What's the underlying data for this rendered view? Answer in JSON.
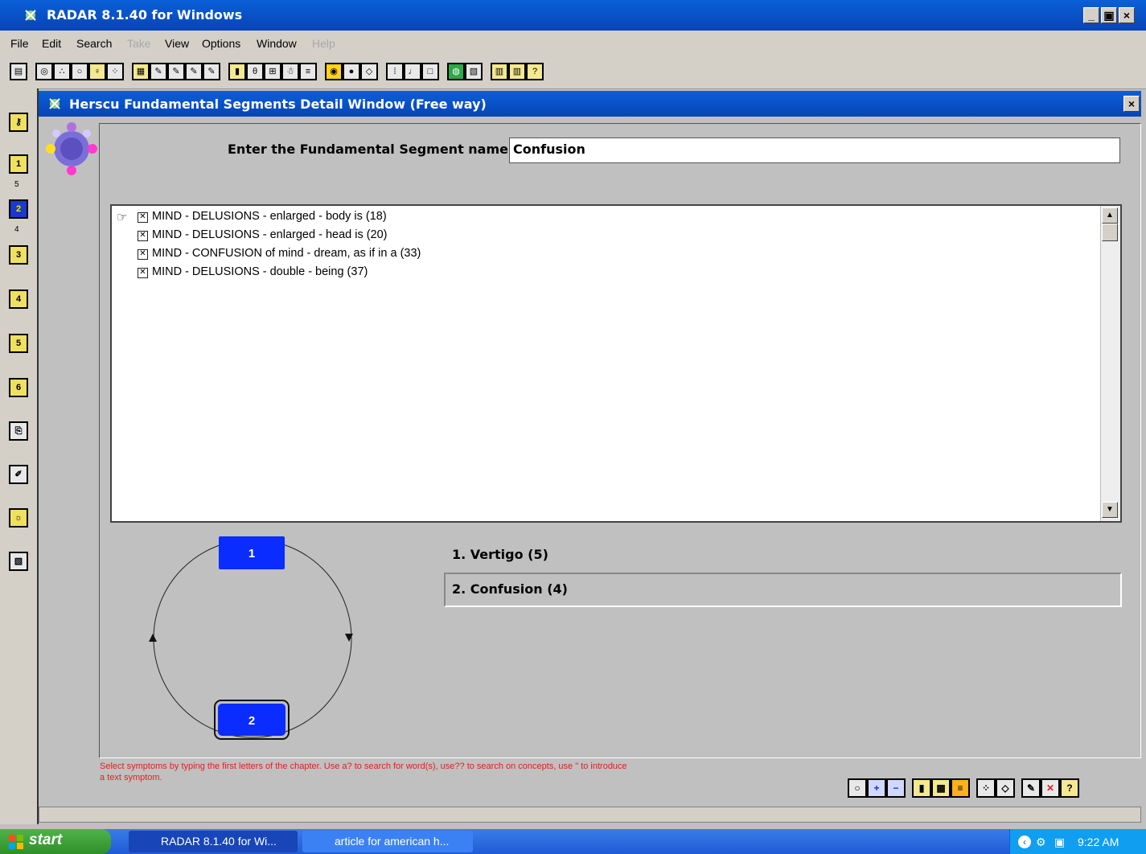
{
  "app": {
    "title": "RADAR 8.1.40 for Windows",
    "window_buttons": [
      "_",
      "▣",
      "×"
    ]
  },
  "menu": [
    {
      "label": "File",
      "enabled": true
    },
    {
      "label": "Edit",
      "enabled": true
    },
    {
      "label": "Search",
      "enabled": true
    },
    {
      "label": "Take",
      "enabled": false
    },
    {
      "label": "View",
      "enabled": true
    },
    {
      "label": "Options",
      "enabled": true
    },
    {
      "label": "Window",
      "enabled": true
    },
    {
      "label": "Help",
      "enabled": false
    }
  ],
  "left_strip": {
    "buttons": [
      "key",
      "1",
      "2",
      "3",
      "4",
      "5",
      "6",
      "copy",
      "chart-edit",
      "bulb",
      "book"
    ],
    "counts": {
      "c1": "5",
      "c2": "4"
    }
  },
  "inner_window": {
    "title": "Herscu Fundamental Segments Detail Window  (Free way)",
    "close": "×"
  },
  "segment": {
    "label": "Enter the Fundamental Segment name:",
    "value": "Confusion"
  },
  "rubrics": [
    "MIND - DELUSIONS - enlarged - body is (18)",
    "MIND - DELUSIONS - enlarged - head is (20)",
    "MIND - CONFUSION of mind - dream, as if in a (33)",
    "MIND - DELUSIONS - double - being (37)"
  ],
  "cycle": {
    "node1": "1",
    "node2": "2"
  },
  "segments_list": [
    "1. Vertigo (5)",
    "2. Confusion (4)"
  ],
  "hint": "Select symptoms by typing the first letters of the chapter.  Use a? to search for word(s), use?? to search on concepts, use \" to introduce a text symptom.",
  "taskbar": {
    "start": "start",
    "tasks": [
      "RADAR 8.1.40 for Wi...",
      "article for american h..."
    ],
    "clock": "9:22 AM"
  },
  "colors": {
    "title_blue": "#0844b6",
    "node_blue": "#0a2cff",
    "hint_red": "#e02020"
  }
}
